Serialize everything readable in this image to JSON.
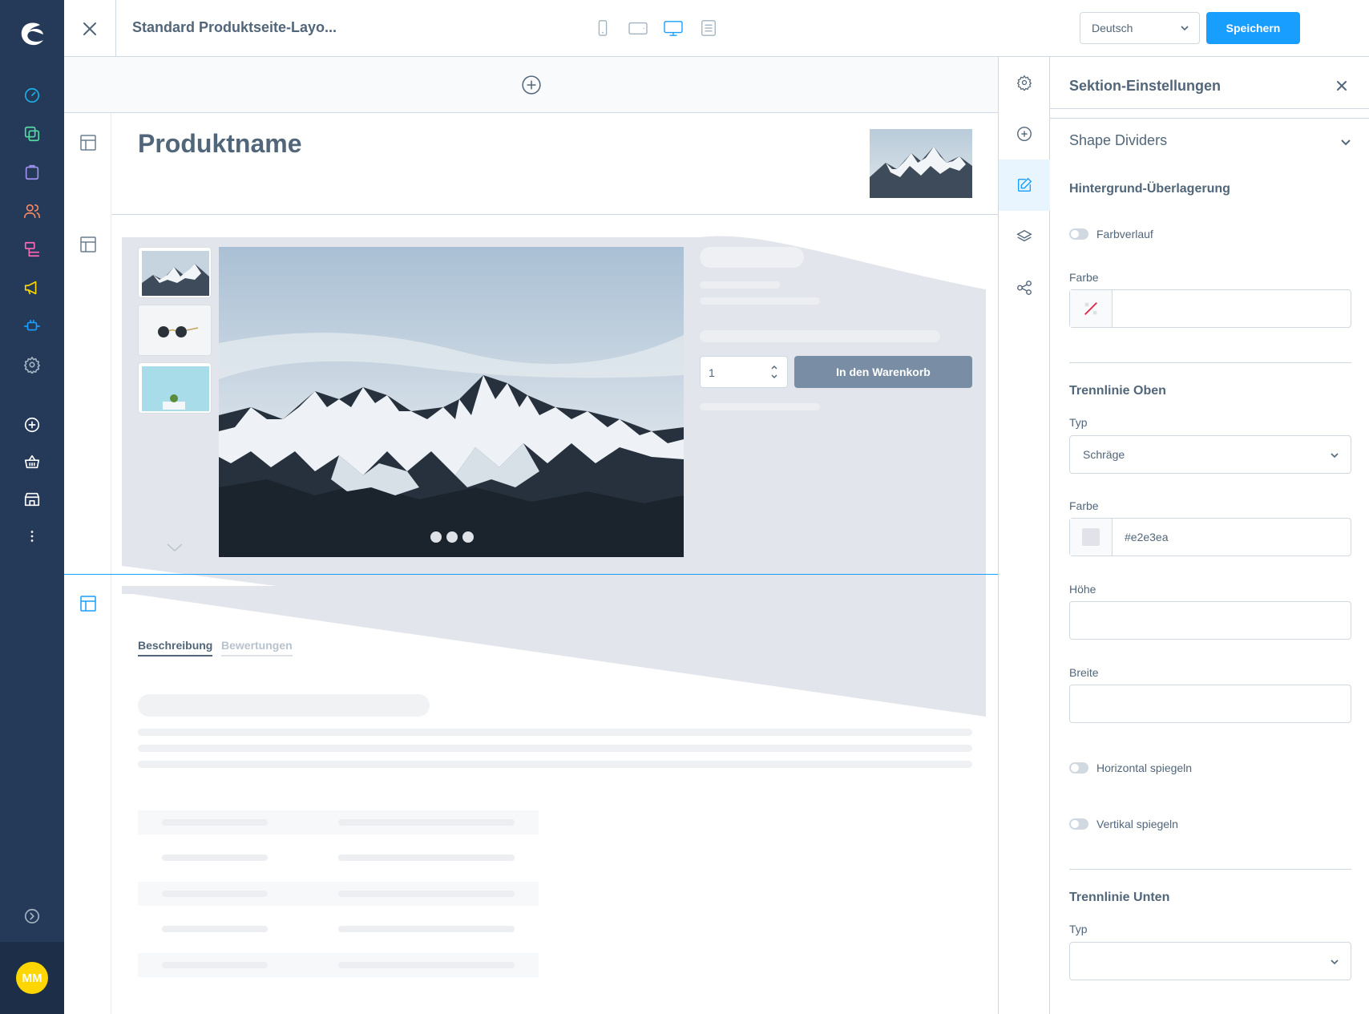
{
  "app": {
    "title": "Standard Produktseite-Layo...",
    "language": "Deutsch",
    "save_label": "Speichern",
    "user_initials": "MM",
    "accent": "#189eff"
  },
  "nav": {
    "icons": [
      "logo-icon",
      "dashboard-icon",
      "catalogue-icon",
      "orders-icon",
      "customers-icon",
      "content-icon",
      "marketing-icon",
      "extensions-icon",
      "settings-icon",
      "add-icon",
      "basket-icon",
      "store-icon",
      "more-icon",
      "help-icon"
    ]
  },
  "viewport": {
    "options": [
      "mobile",
      "tablet",
      "desktop",
      "list"
    ],
    "active": "desktop"
  },
  "canvas": {
    "product_name": "Produktname",
    "quantity": "1",
    "add_to_cart": "In den Warenkorb",
    "tabs": [
      "Beschreibung",
      "Bewertungen"
    ],
    "active_tab": "Beschreibung",
    "slider_dots": 3
  },
  "tools": [
    "settings",
    "add-block",
    "edit",
    "layers",
    "share"
  ],
  "panel": {
    "title": "Sektion-Einstellungen",
    "shape_dividers": "Shape Dividers",
    "overlay_heading": "Hintergrund-Überlagerung",
    "gradient_label": "Farbverlauf",
    "color_label": "Farbe",
    "top_heading": "Trennlinie Oben",
    "type_label": "Typ",
    "top_type": "Schräge",
    "top_color_label": "Farbe",
    "top_color": "#e2e3ea",
    "height_label": "Höhe",
    "width_label": "Breite",
    "flip_h": "Horizontal spiegeln",
    "flip_v": "Vertikal spiegeln",
    "bottom_heading": "Trennlinie Unten",
    "bottom_type_label": "Typ"
  }
}
